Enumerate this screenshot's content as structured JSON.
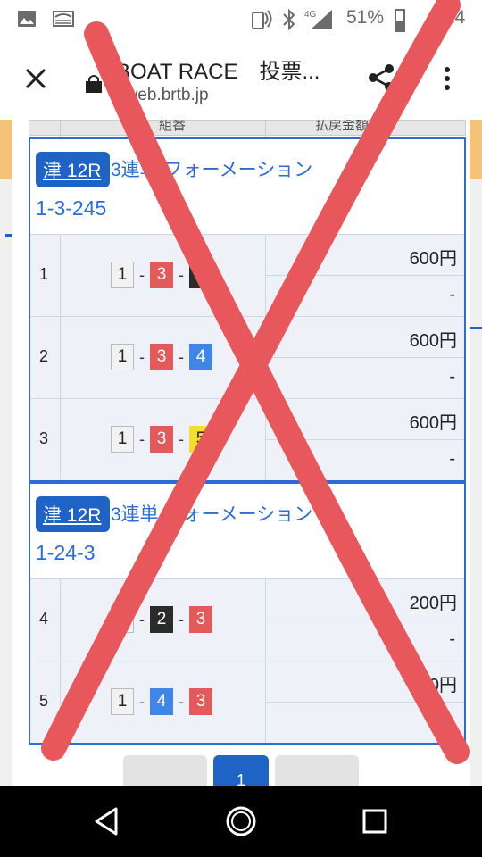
{
  "status_bar": {
    "battery_percent": "51%",
    "time_partial": "24",
    "network": "4G"
  },
  "toolbar": {
    "title": "BOAT RACE　投票...",
    "url": "eweb.brtb.jp"
  },
  "table_header": {
    "col_combo": "組番",
    "col_amount": "払戻金額"
  },
  "groups": [
    {
      "venue": "津 12R",
      "bet_type": "3連単 フォーメーション",
      "combo": "1-3-245",
      "rows": [
        {
          "no": "1",
          "boats": [
            "1",
            "3",
            "2"
          ],
          "amount": "600円",
          "payout": "-"
        },
        {
          "no": "2",
          "boats": [
            "1",
            "3",
            "4"
          ],
          "amount": "600円",
          "payout": "-"
        },
        {
          "no": "3",
          "boats": [
            "1",
            "3",
            "5"
          ],
          "amount": "600円",
          "payout": "-"
        }
      ]
    },
    {
      "venue": "津 12R",
      "bet_type": "3連単 フォーメーション",
      "combo": "1-24-3",
      "rows": [
        {
          "no": "4",
          "boats": [
            "1",
            "2",
            "3"
          ],
          "amount": "200円",
          "payout": "-"
        },
        {
          "no": "5",
          "boats": [
            "1",
            "4",
            "3"
          ],
          "amount": "200円",
          "payout": "-"
        }
      ]
    }
  ],
  "pagination": {
    "current_page": "1"
  },
  "colors": {
    "accent": "#1f63c7",
    "x_mark": "#e8575c",
    "boat_1": "#f2f2f2",
    "boat_2": "#2b2b2b",
    "boat_3": "#e45959",
    "boat_4": "#3f86e8",
    "boat_5": "#f5dc2e"
  }
}
